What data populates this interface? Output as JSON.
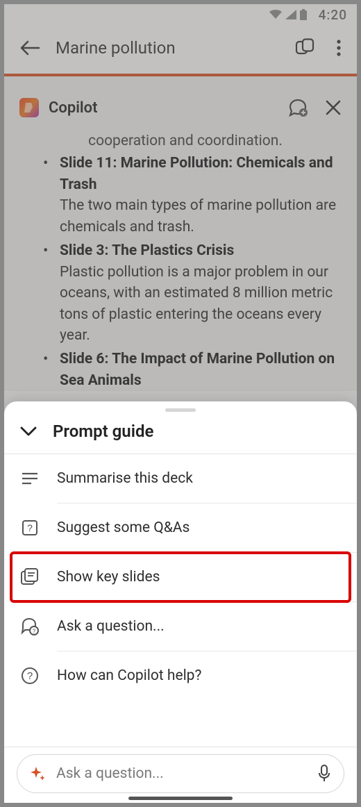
{
  "status": {
    "time": "4:20"
  },
  "header": {
    "title": "Marine pollution"
  },
  "copilot": {
    "title": "Copilot",
    "truncated_line": "cooperation and coordination.",
    "slides": [
      {
        "title": "Slide 11: Marine Pollution: Chemicals and Trash",
        "desc": "The two main types of marine pollution are chemicals and trash."
      },
      {
        "title": "Slide 3: The Plastics Crisis",
        "desc": "Plastic pollution is a major problem in our oceans, with an estimated 8 million metric tons of plastic entering the oceans every year."
      },
      {
        "title": "Slide 6: The Impact of Marine Pollution on Sea Animals",
        "desc": ""
      }
    ]
  },
  "sheet": {
    "title": "Prompt guide",
    "items": {
      "summarise": "Summarise this deck",
      "suggest_qa": "Suggest some Q&As",
      "key_slides": "Show key slides",
      "ask_question": "Ask a question...",
      "how_help": "How can Copilot help?"
    }
  },
  "input": {
    "placeholder": "Ask a question..."
  }
}
